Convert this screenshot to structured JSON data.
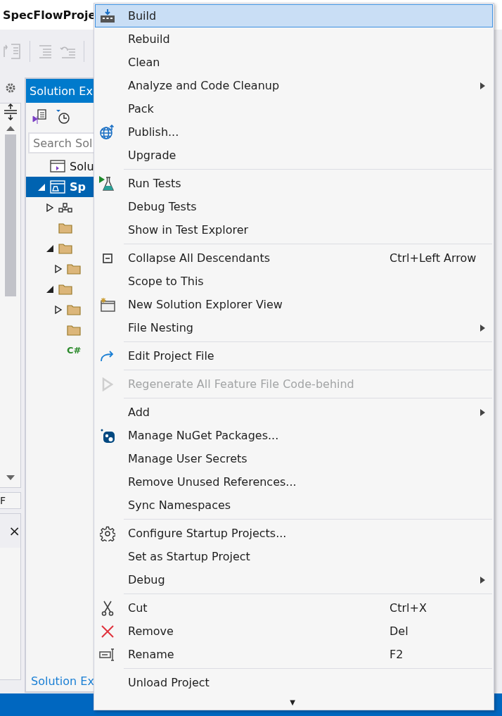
{
  "window": {
    "title": "SpecFlowProje"
  },
  "solution_explorer": {
    "title": "Solution Ex",
    "search": {
      "placeholder": "Search Sol"
    },
    "tree": [
      {
        "label": "Solu",
        "kind": "solution",
        "selected": false
      },
      {
        "label": "Sp",
        "kind": "project",
        "selected": true,
        "expanded": true,
        "children": [
          {
            "kind": "deps",
            "expanded": false
          },
          {
            "kind": "folder"
          },
          {
            "kind": "folder",
            "expanded": true,
            "children": [
              {
                "kind": "folder",
                "expanded": false
              }
            ]
          },
          {
            "kind": "folder",
            "expanded": true,
            "children": [
              {
                "kind": "folder",
                "expanded": false
              },
              {
                "kind": "folder"
              },
              {
                "kind": "csharp",
                "label": "C#"
              }
            ]
          }
        ]
      }
    ],
    "bottom_tab": "Solution Ex"
  },
  "left_panel": {
    "label": "F",
    "close": "×"
  },
  "context_menu": {
    "groups": [
      [
        {
          "label": "Build",
          "kind": "build",
          "selected": true
        },
        {
          "label": "Rebuild",
          "selected": false
        },
        {
          "label": "Clean",
          "selected": false
        },
        {
          "label": "Analyze and Code Cleanup",
          "submenu": true,
          "selected": false
        },
        {
          "label": "Pack",
          "selected": false
        },
        {
          "label": "Publish...",
          "kind": "publish",
          "selected": false
        },
        {
          "label": "Upgrade",
          "selected": false
        }
      ],
      [
        {
          "label": "Run Tests",
          "kind": "tests",
          "selected": false
        },
        {
          "label": "Debug Tests",
          "selected": false
        },
        {
          "label": "Show in Test Explorer",
          "selected": false
        }
      ],
      [
        {
          "label": "Collapse All Descendants",
          "kind": "collapse",
          "shortcut": "Ctrl+Left Arrow",
          "selected": false
        },
        {
          "label": "Scope to This",
          "selected": false
        },
        {
          "label": "New Solution Explorer View",
          "kind": "newview",
          "selected": false
        },
        {
          "label": "File Nesting",
          "submenu": true,
          "selected": false
        }
      ],
      [
        {
          "label": "Edit Project File",
          "kind": "edit",
          "selected": false
        }
      ],
      [
        {
          "label": "Regenerate All Feature File Code-behind",
          "kind": "regenerate",
          "disabled": true,
          "selected": false
        }
      ],
      [
        {
          "label": "Add",
          "submenu": true,
          "selected": false
        },
        {
          "label": "Manage NuGet Packages...",
          "kind": "nuget",
          "selected": false
        },
        {
          "label": "Manage User Secrets",
          "selected": false
        },
        {
          "label": "Remove Unused References...",
          "selected": false
        },
        {
          "label": "Sync Namespaces",
          "selected": false
        }
      ],
      [
        {
          "label": "Configure Startup Projects...",
          "kind": "gear",
          "selected": false
        },
        {
          "label": "Set as Startup Project",
          "selected": false
        },
        {
          "label": "Debug",
          "submenu": true,
          "selected": false
        }
      ],
      [
        {
          "label": "Cut",
          "kind": "cut",
          "shortcut": "Ctrl+X",
          "selected": false
        },
        {
          "label": "Remove",
          "kind": "remove",
          "shortcut": "Del",
          "selected": false
        },
        {
          "label": "Rename",
          "kind": "rename",
          "shortcut": "F2",
          "selected": false
        }
      ],
      [
        {
          "label": "Unload Project",
          "selected": false
        }
      ]
    ],
    "more": "▼"
  }
}
